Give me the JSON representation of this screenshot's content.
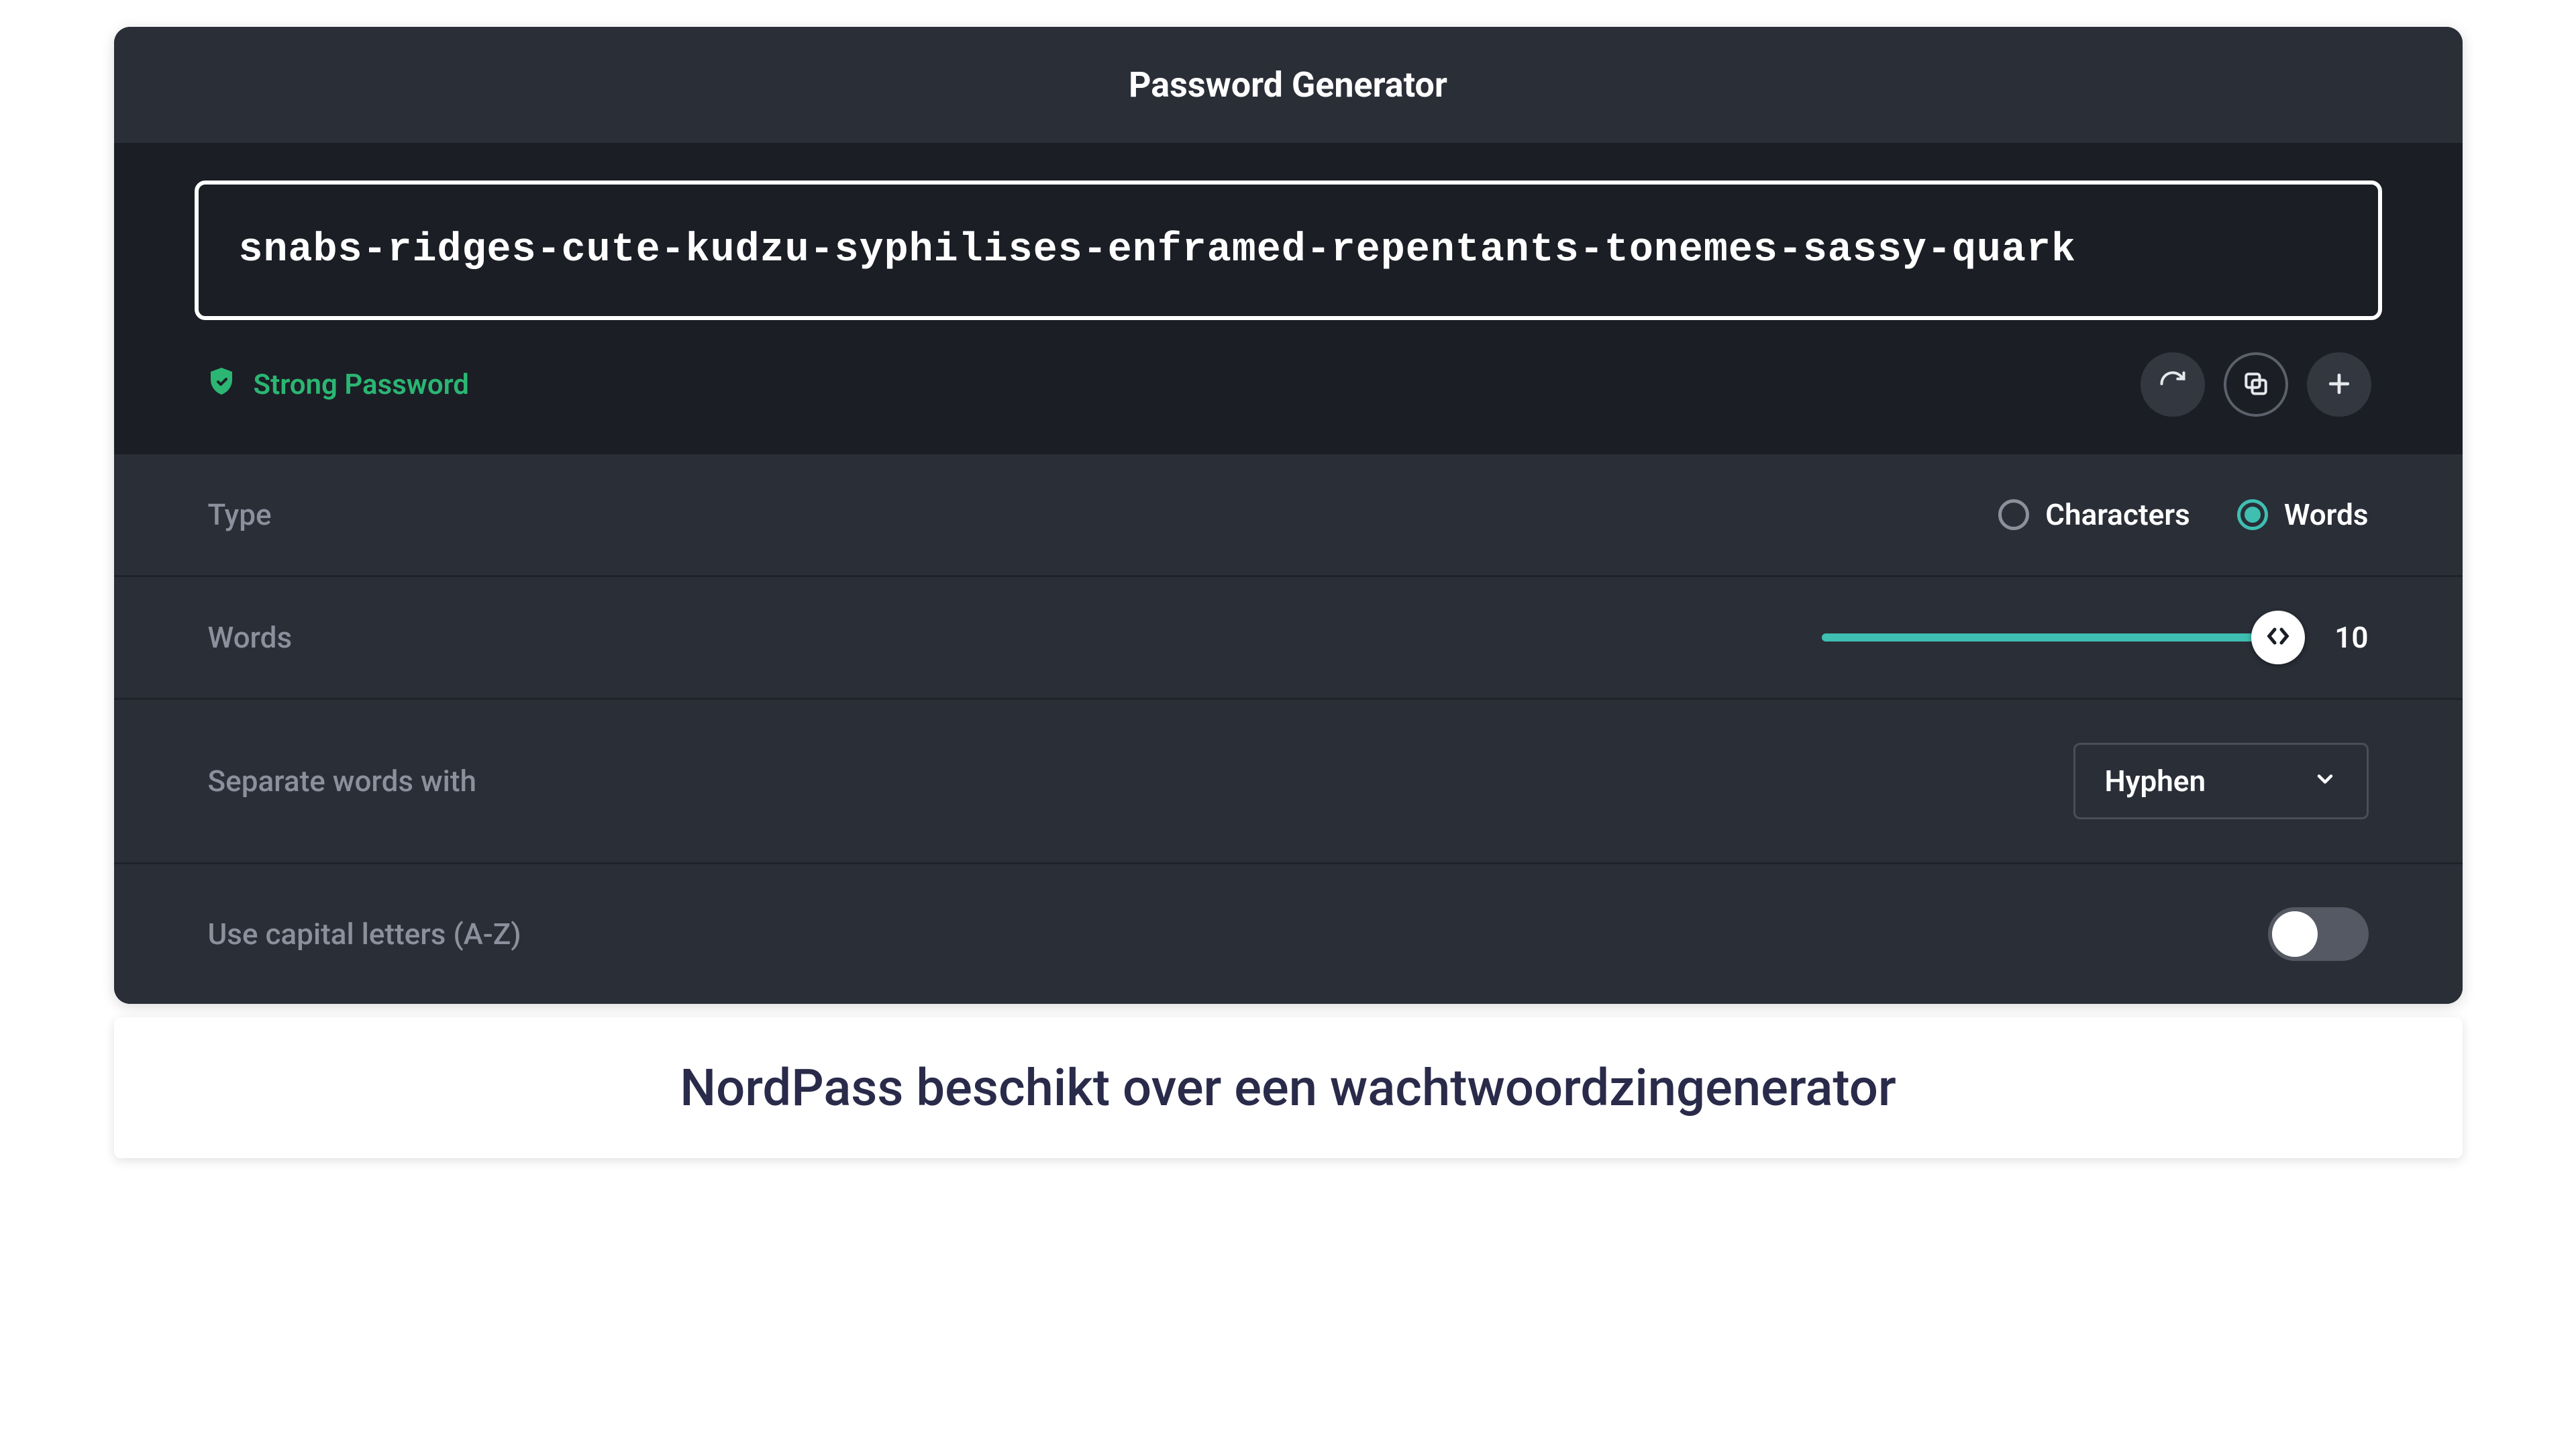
{
  "header": {
    "title": "Password Generator"
  },
  "password": {
    "value": "snabs-ridges-cute-kudzu-syphilises-enframed-repentants-tonemes-sassy-quark",
    "strength_label": "Strong Password"
  },
  "actions": {
    "refresh": "refresh-icon",
    "copy": "copy-icon",
    "add": "plus-icon"
  },
  "settings": {
    "type": {
      "label": "Type",
      "options": [
        {
          "label": "Characters",
          "selected": false
        },
        {
          "label": "Words",
          "selected": true
        }
      ]
    },
    "words": {
      "label": "Words",
      "value": "10"
    },
    "separator": {
      "label": "Separate words with",
      "selected": "Hyphen"
    },
    "capitals": {
      "label": "Use capital letters (A-Z)",
      "enabled": false
    }
  },
  "colors": {
    "accent": "#3ebfb2",
    "success": "#2bb673",
    "bg_dark": "#1b1e25",
    "bg_panel": "#2a2e37"
  },
  "caption": "NordPass beschikt over een wachtwoordzingenerator"
}
